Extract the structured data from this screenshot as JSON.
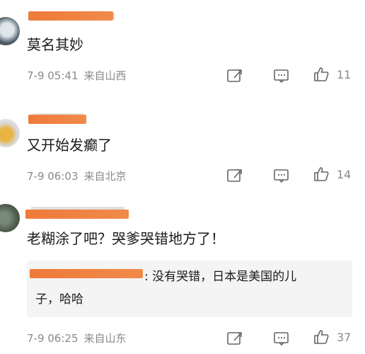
{
  "colors": {
    "redact": "#ef7a3a",
    "meta_gray": "#8a8a8a",
    "reply_bg": "#f4f4f4"
  },
  "comments": [
    {
      "text": "莫名其妙",
      "date": "7-9 05:41",
      "location": "来自山西",
      "likes": "11",
      "icons": [
        "repost-icon",
        "comment-icon",
        "like-icon"
      ]
    },
    {
      "text": "又开始发癫了",
      "date": "7-9 06:03",
      "location": "来自北京",
      "likes": "14",
      "icons": [
        "repost-icon",
        "comment-icon",
        "like-icon"
      ]
    },
    {
      "text": "老糊涂了吧？哭爹哭错地方了！",
      "reply": {
        "line1": ": 没有哭错，日本是美国的儿",
        "line2": "子，哈哈"
      },
      "date": "7-9 06:25",
      "location": "来自山东",
      "likes": "37",
      "icons": [
        "repost-icon",
        "comment-icon",
        "like-icon"
      ]
    }
  ]
}
